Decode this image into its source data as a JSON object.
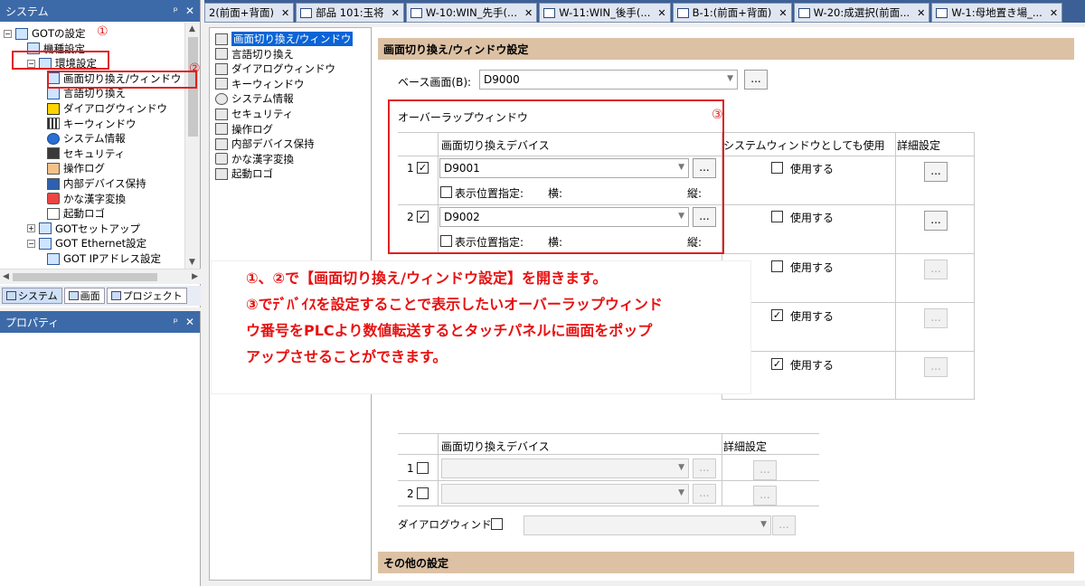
{
  "system_panel": {
    "title": "システム",
    "pin": "ᵖ",
    "close": "✕",
    "tree": [
      {
        "label": "GOTの設定",
        "level": 0,
        "expander": "−",
        "icon": "screen"
      },
      {
        "label": "機種設定",
        "level": 1,
        "expander": "",
        "icon": "screen"
      },
      {
        "label": "環境設定",
        "level": 1,
        "expander": "−",
        "icon": "screen"
      },
      {
        "label": "画面切り換え/ウィンドウ",
        "level": 2,
        "expander": "",
        "icon": "screen"
      },
      {
        "label": "言語切り換え",
        "level": 2,
        "expander": "",
        "icon": "screen"
      },
      {
        "label": "ダイアログウィンドウ",
        "level": 2,
        "expander": "",
        "icon": "warn"
      },
      {
        "label": "キーウィンドウ",
        "level": 2,
        "expander": "",
        "icon": "grid"
      },
      {
        "label": "システム情報",
        "level": 2,
        "expander": "",
        "icon": "info"
      },
      {
        "label": "セキュリティ",
        "level": 2,
        "expander": "",
        "icon": "lock"
      },
      {
        "label": "操作ログ",
        "level": 2,
        "expander": "",
        "icon": "hand"
      },
      {
        "label": "内部デバイス保持",
        "level": 2,
        "expander": "",
        "icon": "dev"
      },
      {
        "label": "かな漢字変換",
        "level": 2,
        "expander": "",
        "icon": "kana"
      },
      {
        "label": "起動ロゴ",
        "level": 2,
        "expander": "",
        "icon": "logo"
      },
      {
        "label": "GOTセットアップ",
        "level": 1,
        "expander": "+",
        "icon": "screen"
      },
      {
        "label": "GOT Ethernet設定",
        "level": 1,
        "expander": "−",
        "icon": "screen"
      },
      {
        "label": "GOT IPアドレス設定",
        "level": 2,
        "expander": "",
        "icon": "screen"
      }
    ],
    "bottom_tabs": [
      "システム",
      "画面",
      "プロジェクト"
    ]
  },
  "property_panel": {
    "title": "プロパティ"
  },
  "doc_tabs": [
    "2(前面+背面)",
    "部品 101:玉将",
    "W-10:WIN_先手(...",
    "W-11:WIN_後手(...",
    "B-1:(前面+背面)",
    "W-20:成選択(前面...",
    "W-1:母地置き場_..."
  ],
  "settings_tree": [
    {
      "label": "画面切り換え/ウィンドウ",
      "icon": "screen",
      "selected": true
    },
    {
      "label": "言語切り換え",
      "icon": "screen"
    },
    {
      "label": "ダイアログウィンドウ",
      "icon": "warn"
    },
    {
      "label": "キーウィンドウ",
      "icon": "grid"
    },
    {
      "label": "システム情報",
      "icon": "info"
    },
    {
      "label": "セキュリティ",
      "icon": "lock"
    },
    {
      "label": "操作ログ",
      "icon": "hand"
    },
    {
      "label": "内部デバイス保持",
      "icon": "dev"
    },
    {
      "label": "かな漢字変換",
      "icon": "kana"
    },
    {
      "label": "起動ロゴ",
      "icon": "logo"
    }
  ],
  "form": {
    "section_title": "画面切り換え/ウィンドウ設定",
    "base_screen_label": "ベース画面(B):",
    "base_screen_value": "D9000",
    "dots": "...",
    "overlap_title": "オーバーラップウィンドウ",
    "col_device": "画面切り換えデバイス",
    "col_system": "システムウィンドウとしても使用",
    "col_detail": "詳細設定",
    "use_label": "使用する",
    "pos_label": "表示位置指定:",
    "horiz": "横:",
    "vert": "縦:",
    "rows": [
      {
        "num": "1",
        "checked": true,
        "device": "D9001",
        "use": false
      },
      {
        "num": "2",
        "checked": true,
        "device": "D9002",
        "use": false
      },
      {
        "use": false
      },
      {
        "use": true
      },
      {
        "use": true
      }
    ],
    "superimpose_rows": [
      {
        "num": "1"
      },
      {
        "num": "2"
      }
    ],
    "dialog_label": "ダイアログウィンドウ",
    "other_title": "その他の設定"
  },
  "annotations": {
    "m1": "①",
    "m2": "②",
    "m3": "③",
    "callout_lines": [
      "①、②で【画面切り換え/ウィンドウ設定】を開きます。",
      "③でﾃﾞﾊﾞｲｽを設定することで表示したいオーバーラップウィンド",
      "ウ番号をPLCより数値転送するとタッチパネルに画面をポップ",
      "アップさせることができます。"
    ]
  }
}
